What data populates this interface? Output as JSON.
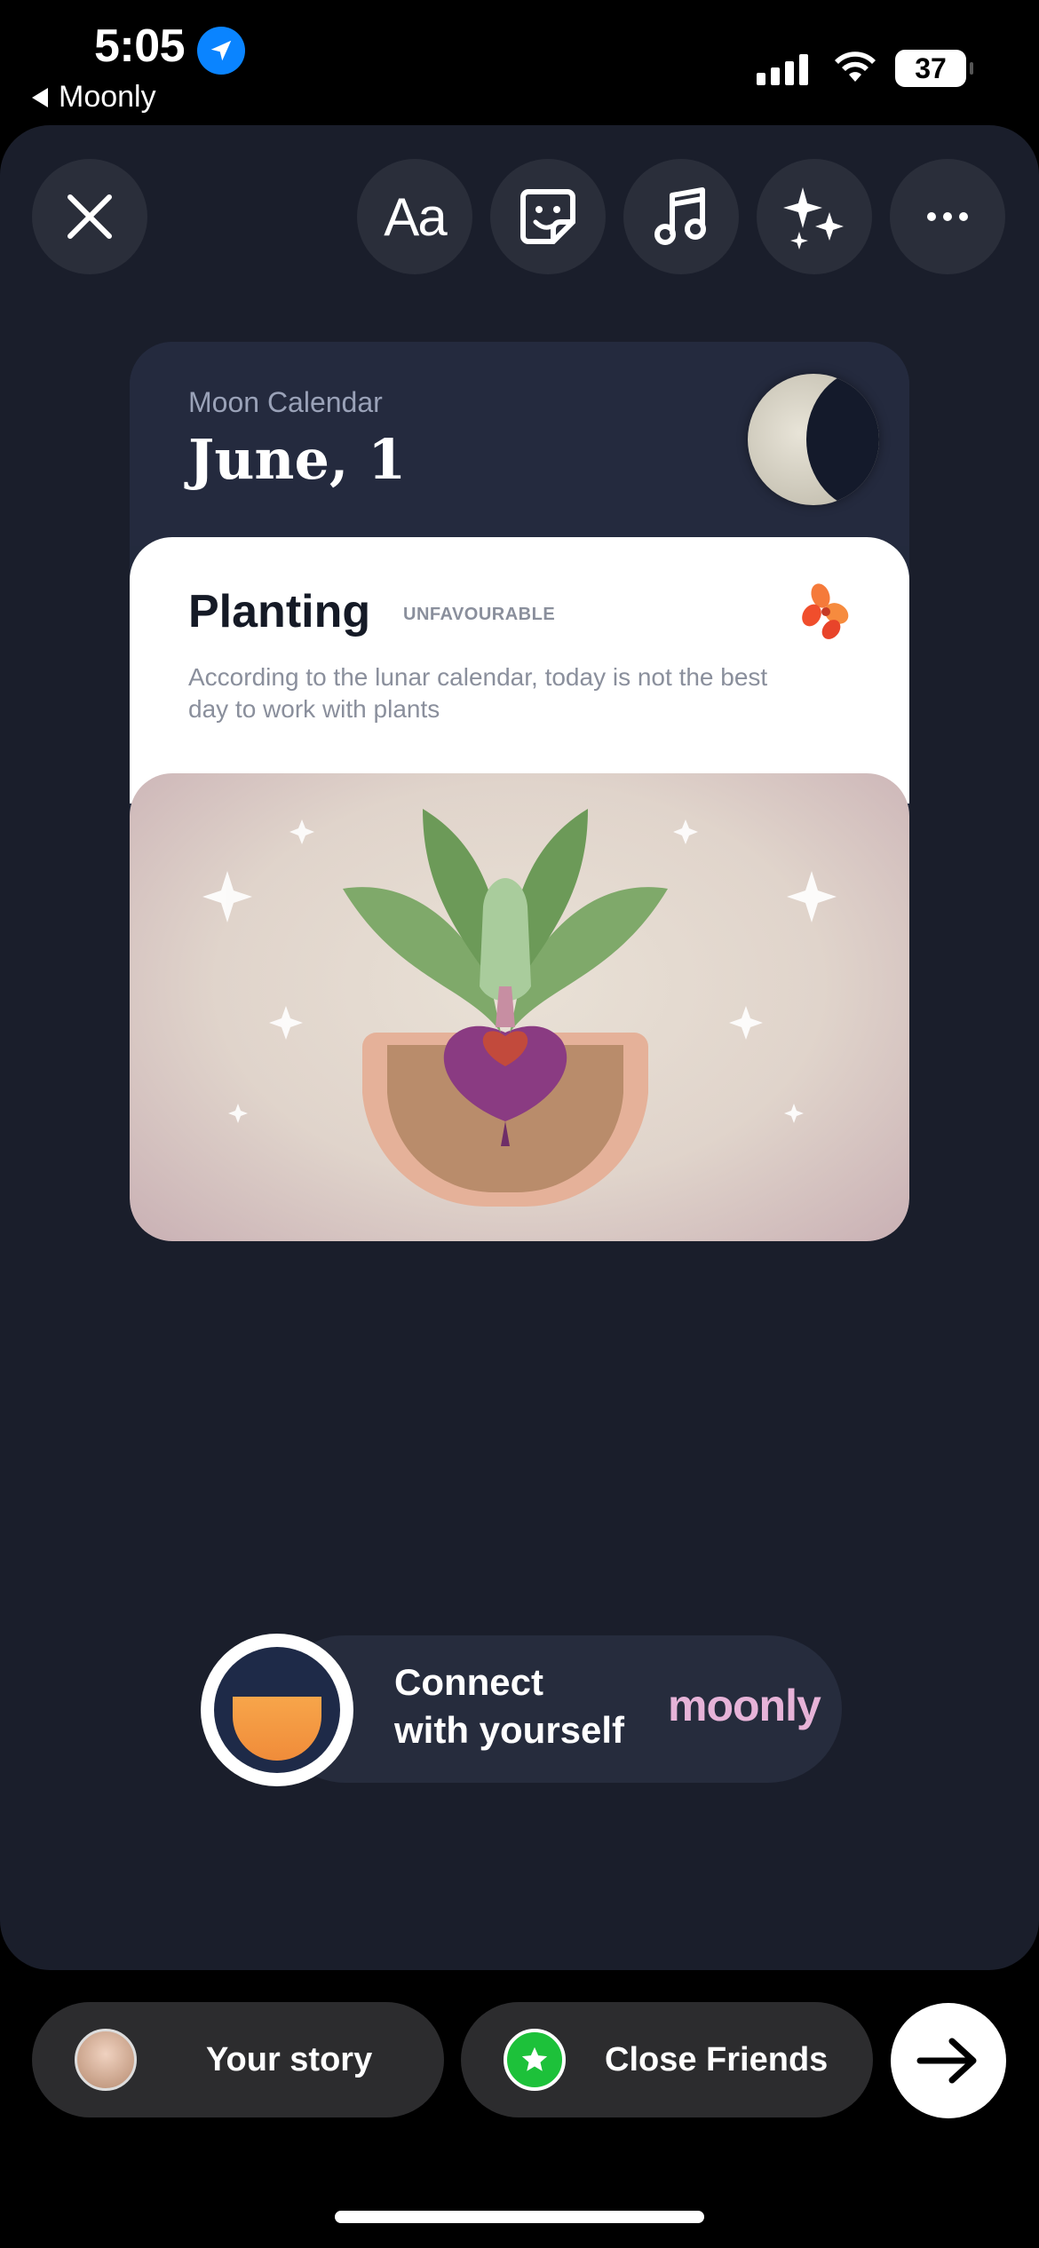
{
  "status_bar": {
    "time": "5:05",
    "back_app": "Moonly",
    "battery": "37"
  },
  "toolbar": {
    "close": "close-icon",
    "text_tool": "Aa",
    "sticker": "sticker-icon",
    "music": "music-note-icon",
    "effects": "sparkles-icon",
    "more": "more-icon"
  },
  "card": {
    "subtitle": "Moon Calendar",
    "date": "June, 1",
    "activity": "Planting",
    "tag": "UNFAVOURABLE",
    "description": "According to the lunar calendar, today is not the best day to work with plants"
  },
  "brand": {
    "tagline_line1": "Connect",
    "tagline_line2": "with yourself",
    "wordmark": "moonly"
  },
  "share": {
    "your_story": "Your story",
    "close_friends": "Close Friends"
  },
  "colors": {
    "canvas_bg": "#1a1e2b",
    "wordmark": "#e6b3d8",
    "close_friends_green": "#1dc13a",
    "location_blue": "#0a84ff"
  }
}
